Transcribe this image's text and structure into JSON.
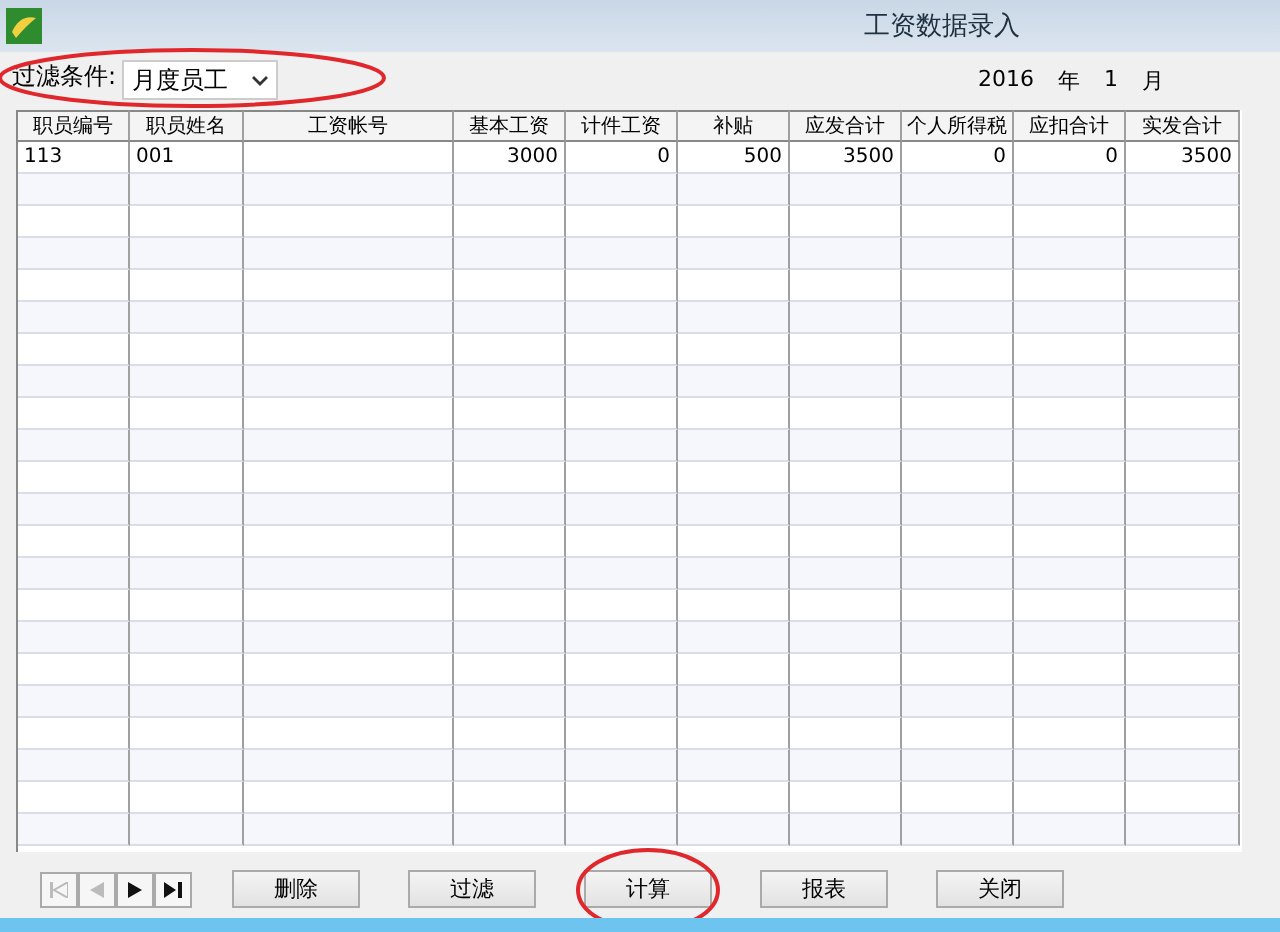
{
  "window": {
    "title": "工资数据录入"
  },
  "filter": {
    "label": "过滤条件:",
    "value": "月度员工",
    "highlighted": true
  },
  "period": {
    "year": "2016",
    "year_unit": "年",
    "month": "1",
    "month_unit": "月"
  },
  "table": {
    "columns": [
      {
        "label": "职员编号"
      },
      {
        "label": "职员姓名"
      },
      {
        "label": "工资帐号"
      },
      {
        "label": "基本工资"
      },
      {
        "label": "计件工资"
      },
      {
        "label": "补贴"
      },
      {
        "label": "应发合计"
      },
      {
        "label": "个人所得税"
      },
      {
        "label": "应扣合计"
      },
      {
        "label": "实发合计"
      }
    ],
    "rows": [
      [
        "113",
        "001",
        "",
        "3000",
        "0",
        "500",
        "3500",
        "0",
        "0",
        "3500"
      ]
    ]
  },
  "navigator": [
    {
      "kind": "first",
      "disabled": true
    },
    {
      "kind": "prev",
      "disabled": true
    },
    {
      "kind": "next",
      "disabled": false
    },
    {
      "kind": "last",
      "disabled": false
    }
  ],
  "buttons": [
    {
      "label": "删除",
      "highlighted": false
    },
    {
      "label": "过滤",
      "highlighted": false
    },
    {
      "label": "计算",
      "highlighted": true
    },
    {
      "label": "报表",
      "highlighted": false
    },
    {
      "label": "关闭",
      "highlighted": false
    }
  ]
}
